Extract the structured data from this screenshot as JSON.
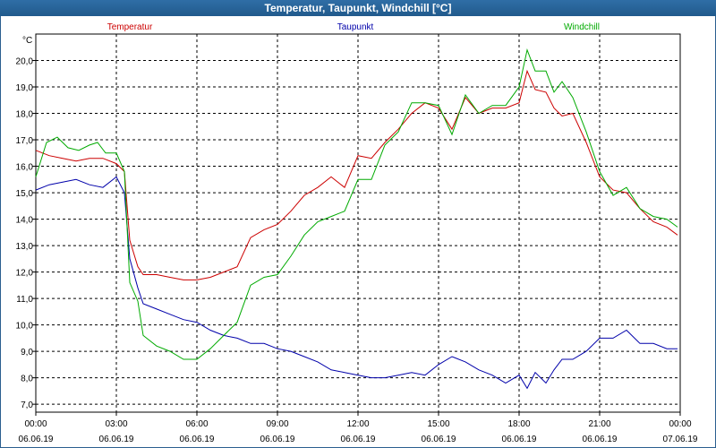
{
  "window": {
    "title": "Temperatur, Taupunkt, Windchill [°C]"
  },
  "chart_data": {
    "type": "line",
    "title": "Temperatur, Taupunkt, Windchill [°C]",
    "ylabel": "°C",
    "ylim": [
      6.7,
      21.0
    ],
    "yticks": [
      "7,0",
      "8,0",
      "9,0",
      "10,0",
      "11,0",
      "12,0",
      "13,0",
      "14,0",
      "15,0",
      "16,0",
      "17,0",
      "18,0",
      "19,0",
      "20,0"
    ],
    "ytick_values": [
      7,
      8,
      9,
      10,
      11,
      12,
      13,
      14,
      15,
      16,
      17,
      18,
      19,
      20
    ],
    "xlim": [
      0,
      24
    ],
    "xticks": [
      {
        "time": "00:00",
        "date": "06.06.19",
        "h": 0
      },
      {
        "time": "03:00",
        "date": "06.06.19",
        "h": 3
      },
      {
        "time": "06:00",
        "date": "06.06.19",
        "h": 6
      },
      {
        "time": "09:00",
        "date": "06.06.19",
        "h": 9
      },
      {
        "time": "12:00",
        "date": "06.06.19",
        "h": 12
      },
      {
        "time": "15:00",
        "date": "06.06.19",
        "h": 15
      },
      {
        "time": "18:00",
        "date": "06.06.19",
        "h": 18
      },
      {
        "time": "21:00",
        "date": "06.06.19",
        "h": 21
      },
      {
        "time": "00:00",
        "date": "07.06.19",
        "h": 24
      }
    ],
    "grid": true,
    "legend_placement": "top",
    "series": [
      {
        "name": "Temperatur",
        "color": "#cc0000",
        "x": [
          0,
          0.5,
          1,
          1.5,
          2,
          2.5,
          3,
          3.3,
          3.5,
          3.8,
          4,
          4.5,
          5,
          5.5,
          6,
          6.5,
          7,
          7.5,
          8,
          8.5,
          9,
          9.5,
          10,
          10.5,
          11,
          11.5,
          12,
          12.5,
          13,
          13.5,
          14,
          14.5,
          15,
          15.5,
          16,
          16.5,
          17,
          17.5,
          18,
          18.3,
          18.6,
          19,
          19.3,
          19.6,
          20,
          20.5,
          21,
          21.5,
          22,
          22.5,
          23,
          23.5,
          23.9
        ],
        "y": [
          16.6,
          16.4,
          16.3,
          16.2,
          16.3,
          16.3,
          16.1,
          15.8,
          13.2,
          12.2,
          11.9,
          11.9,
          11.8,
          11.7,
          11.7,
          11.8,
          12.0,
          12.2,
          13.3,
          13.6,
          13.8,
          14.3,
          14.9,
          15.2,
          15.6,
          15.2,
          16.4,
          16.3,
          16.9,
          17.4,
          18.0,
          18.4,
          18.2,
          17.4,
          18.6,
          18.0,
          18.2,
          18.2,
          18.4,
          19.6,
          18.9,
          18.8,
          18.2,
          17.9,
          18.0,
          16.9,
          15.6,
          15.1,
          15.0,
          14.4,
          13.9,
          13.7,
          13.4
        ]
      },
      {
        "name": "Taupunkt",
        "color": "#0000aa",
        "x": [
          0,
          0.5,
          1,
          1.5,
          2,
          2.5,
          3,
          3.3,
          3.5,
          3.8,
          4,
          4.5,
          5,
          5.5,
          6,
          6.5,
          7,
          7.5,
          8,
          8.5,
          9,
          9.5,
          10,
          10.5,
          11,
          11.5,
          12,
          12.5,
          13,
          13.5,
          14,
          14.5,
          15,
          15.5,
          16,
          16.5,
          17,
          17.5,
          18,
          18.3,
          18.6,
          19,
          19.3,
          19.6,
          20,
          20.5,
          21,
          21.5,
          22,
          22.5,
          23,
          23.5,
          23.9
        ],
        "y": [
          15.1,
          15.3,
          15.4,
          15.5,
          15.3,
          15.2,
          15.6,
          15.0,
          12.5,
          11.4,
          10.8,
          10.6,
          10.4,
          10.2,
          10.1,
          9.8,
          9.6,
          9.5,
          9.3,
          9.3,
          9.1,
          9.0,
          8.8,
          8.6,
          8.3,
          8.2,
          8.1,
          8.0,
          8.0,
          8.1,
          8.2,
          8.1,
          8.5,
          8.8,
          8.6,
          8.3,
          8.1,
          7.8,
          8.1,
          7.6,
          8.2,
          7.8,
          8.3,
          8.7,
          8.7,
          9.0,
          9.5,
          9.5,
          9.8,
          9.3,
          9.3,
          9.1,
          9.1
        ]
      },
      {
        "name": "Windchill",
        "color": "#00aa00",
        "x": [
          0,
          0.4,
          0.8,
          1.2,
          1.6,
          2,
          2.3,
          2.6,
          3,
          3.3,
          3.5,
          3.8,
          4,
          4.5,
          5,
          5.5,
          6,
          6.5,
          7,
          7.5,
          8,
          8.5,
          9,
          9.5,
          10,
          10.5,
          11,
          11.5,
          12,
          12.5,
          13,
          13.5,
          14,
          14.5,
          15,
          15.5,
          16,
          16.5,
          17,
          17.5,
          18,
          18.3,
          18.6,
          19,
          19.3,
          19.6,
          20,
          20.5,
          21,
          21.5,
          22,
          22.5,
          23,
          23.5,
          23.9
        ],
        "y": [
          15.6,
          16.9,
          17.1,
          16.7,
          16.6,
          16.8,
          16.9,
          16.5,
          16.5,
          15.8,
          11.6,
          10.9,
          9.6,
          9.2,
          9.0,
          8.7,
          8.7,
          9.1,
          9.6,
          10.1,
          11.5,
          11.8,
          11.9,
          12.6,
          13.4,
          13.9,
          14.1,
          14.3,
          15.5,
          15.5,
          16.8,
          17.3,
          18.4,
          18.4,
          18.3,
          17.2,
          18.7,
          18.0,
          18.3,
          18.3,
          19.0,
          20.4,
          19.6,
          19.6,
          18.8,
          19.2,
          18.6,
          17.3,
          15.8,
          14.9,
          15.2,
          14.4,
          14.1,
          14.0,
          13.7
        ]
      }
    ]
  }
}
